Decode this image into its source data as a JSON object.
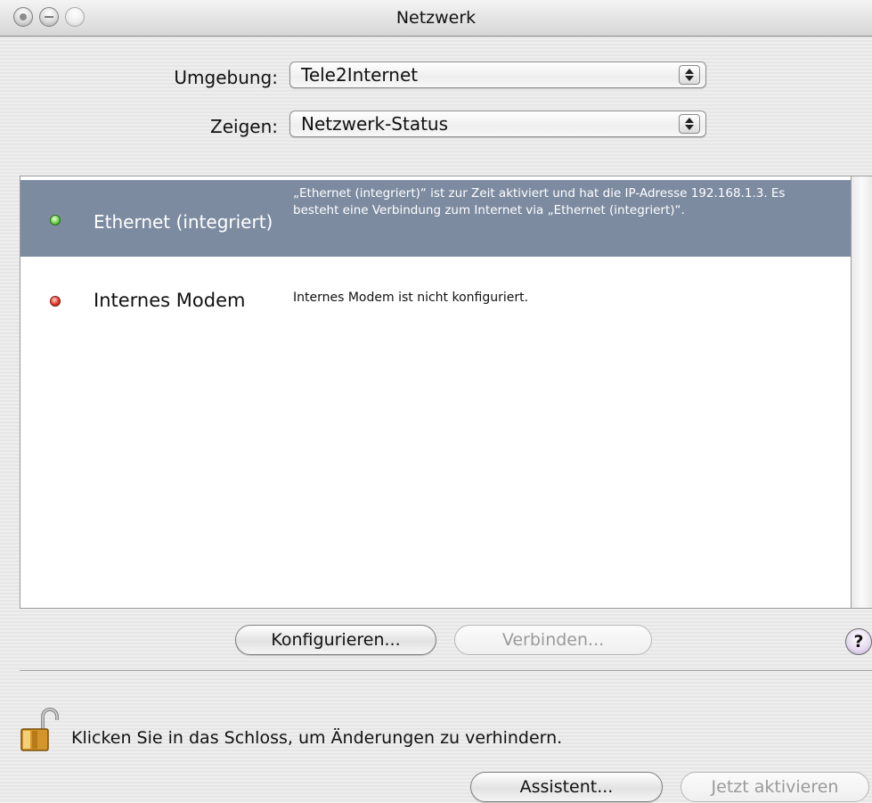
{
  "window": {
    "title": "Netzwerk"
  },
  "location": {
    "label": "Umgebung:",
    "value": "Tele2Internet"
  },
  "show": {
    "label": "Zeigen:",
    "value": "Netzwerk-Status"
  },
  "status_list": [
    {
      "name": "Ethernet (integriert)",
      "status": "green",
      "description": "„Ethernet (integriert)“ ist zur Zeit aktiviert und hat die IP-Adresse 192.168.1.3. Es besteht eine Verbindung zum Internet via „Ethernet (integriert)“.",
      "selected": true
    },
    {
      "name": "Internes Modem",
      "status": "red",
      "description": "Internes Modem ist nicht konfiguriert.",
      "selected": false
    }
  ],
  "buttons": {
    "configure": "Konfigurieren...",
    "connect": "Verbinden...",
    "help": "?",
    "assistant": "Assistent...",
    "apply": "Jetzt aktivieren"
  },
  "lock": {
    "text": "Klicken Sie in das Schloss, um Änderungen zu verhindern.",
    "icon": "open-lock-icon"
  },
  "colors": {
    "selection": "#7d8ba1",
    "status_green": "#6cd34a",
    "status_red": "#e43a2c"
  }
}
